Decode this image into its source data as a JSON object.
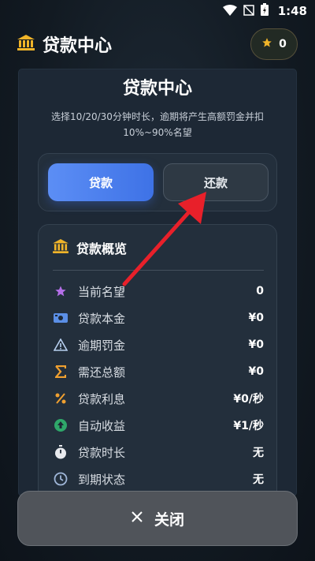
{
  "status_bar": {
    "time": "1:48"
  },
  "header": {
    "title": "贷款中心",
    "star_count": "0"
  },
  "panel": {
    "title": "贷款中心",
    "subtitle": "选择10/20/30分钟时长，逾期将产生高额罚金并扣10%~90%名望",
    "tabs": [
      {
        "label": "贷款",
        "selected": true
      },
      {
        "label": "还款",
        "selected": false
      }
    ]
  },
  "overview": {
    "title": "贷款概览",
    "rows": [
      {
        "icon": "star-icon",
        "label": "当前名望",
        "value": "0"
      },
      {
        "icon": "money-icon",
        "label": "贷款本金",
        "value": "¥0"
      },
      {
        "icon": "warning-icon",
        "label": "逾期罚金",
        "value": "¥0"
      },
      {
        "icon": "sigma-icon",
        "label": "需还总额",
        "value": "¥0"
      },
      {
        "icon": "percent-icon",
        "label": "贷款利息",
        "value": "¥0/秒"
      },
      {
        "icon": "arrow-up-circle-icon",
        "label": "自动收益",
        "value": "¥1/秒"
      },
      {
        "icon": "stopwatch-icon",
        "label": "贷款时长",
        "value": "无"
      },
      {
        "icon": "clock-icon",
        "label": "到期状态",
        "value": "无"
      }
    ]
  },
  "close_button": {
    "label": "关闭"
  },
  "colors": {
    "accent_blue": "#4a7ff0",
    "gold": "#f0b429",
    "annotation_red": "#e8202a"
  }
}
